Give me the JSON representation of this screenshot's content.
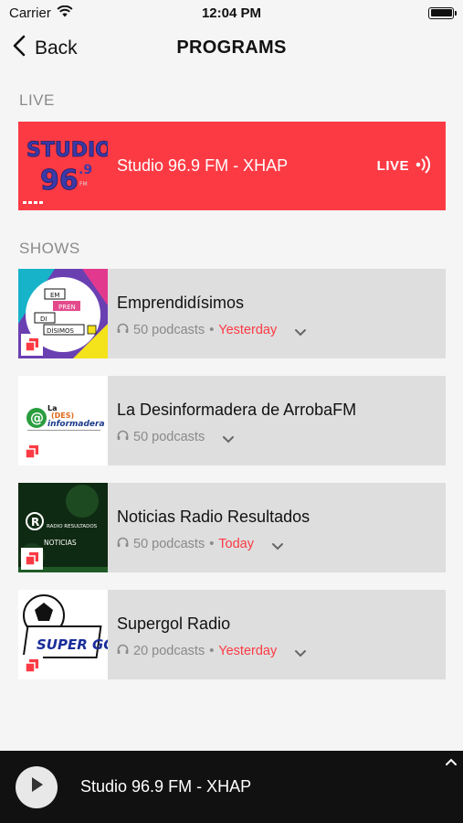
{
  "status_bar": {
    "carrier": "Carrier",
    "time": "12:04 PM"
  },
  "nav": {
    "back_label": "Back",
    "title": "PROGRAMS"
  },
  "live": {
    "section_label": "LIVE",
    "station_title": "Studio 96.9 FM - XHAP",
    "badge": "LIVE",
    "logo_text": "STUDIO",
    "logo_number": "96.9"
  },
  "shows": {
    "section_label": "SHOWS",
    "items": [
      {
        "title": "Emprendidísimos",
        "podcasts": "50 podcasts",
        "date": "Yesterday",
        "thumb_color": "#6a3fb2"
      },
      {
        "title": "La Desinformadera de ArrobaFM",
        "podcasts": "50 podcasts",
        "date": "",
        "thumb_color": "#ffffff"
      },
      {
        "title": "Noticias Radio Resultados",
        "podcasts": "50 podcasts",
        "date": "Today",
        "thumb_color": "#0f2a12"
      },
      {
        "title": "Supergol Radio",
        "podcasts": "20 podcasts",
        "date": "Yesterday",
        "thumb_color": "#ffffff"
      }
    ]
  },
  "thumb_text": {
    "emprend": [
      "EM",
      "PREN",
      "DI",
      "DÍSIMOS"
    ],
    "desinfo": [
      "La",
      "(DES)",
      "informadera"
    ],
    "noticias_brand": "RADIO RESULTADOS",
    "noticias_label": "NOTICIAS",
    "supergol": "SUPER GOL !"
  },
  "player": {
    "now_playing": "Studio 96.9 FM - XHAP"
  },
  "colors": {
    "accent": "#fc3a44",
    "card_bg": "#dedede",
    "player_bg": "#111111"
  }
}
